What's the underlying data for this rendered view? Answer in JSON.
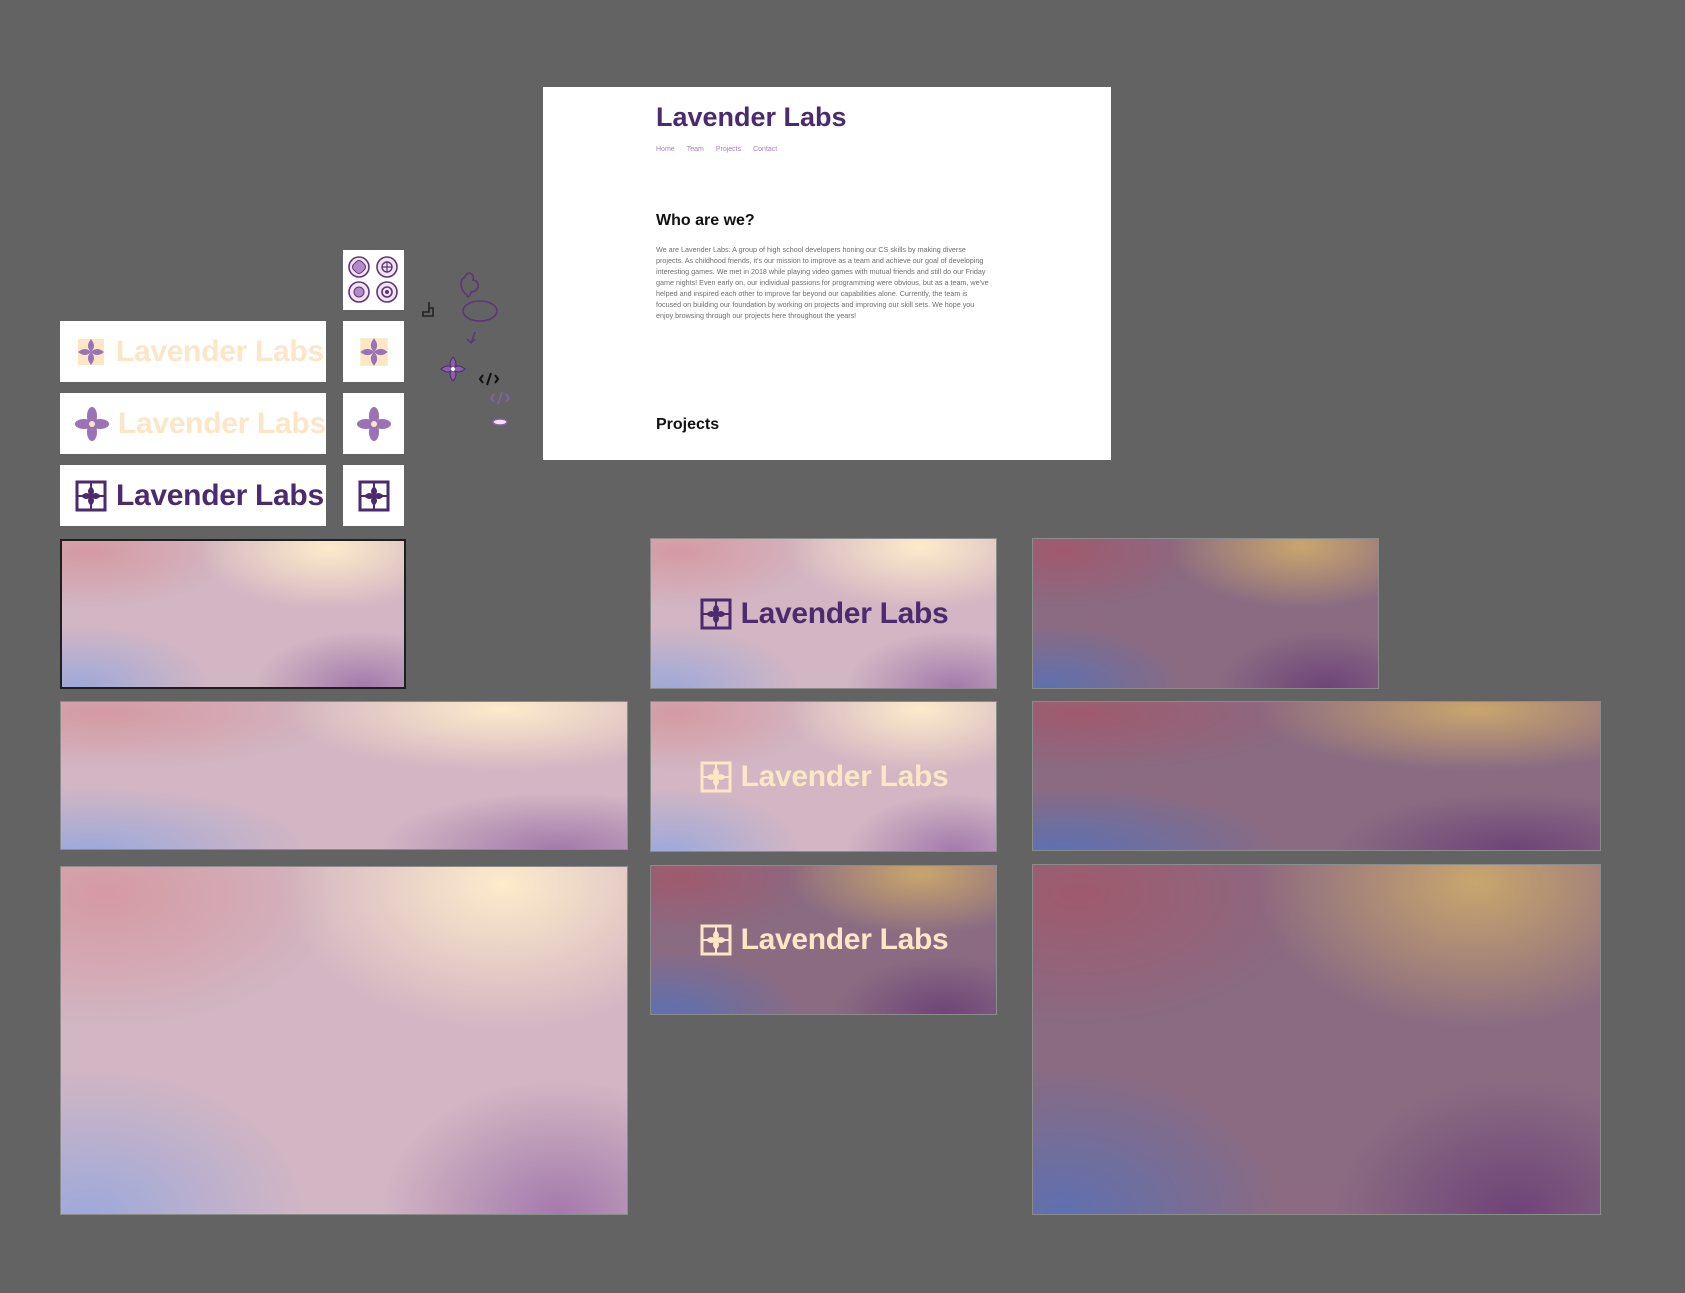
{
  "brand": {
    "name": "Lavender Labs",
    "colors": {
      "purple": "#4b2a6d",
      "cream": "#fcebcc",
      "lavender": "#8a5fa8",
      "canvas": "#636363"
    }
  },
  "website": {
    "title": "Lavender Labs",
    "nav": [
      "Home",
      "Team",
      "Projects",
      "Contact"
    ],
    "about_heading": "Who are we?",
    "about_text": "We are Lavender Labs: A group of high school developers honing our CS skills by making diverse projects. As childhood friends, it's our mission to improve as a team and achieve our goal of developing interesting games. We met in 2018 while playing video games with mutual friends and still do our Friday game nights! Even early on, our individual passions for programming were obvious, but as a team, we've helped and inspired each other to improve far beyond our capabilities alone. Currently, the team is focused on building our foundation by working on projects and improving our skill sets. We hope you enjoy browsing through our projects here throughout the years!",
    "projects_heading": "Projects"
  },
  "icons": {
    "emblem_grid": [
      "emblem-1-icon",
      "emblem-2-icon",
      "emblem-3-icon",
      "emblem-4-icon"
    ],
    "flower": "flower-icon",
    "framed_flower": "framed-flower-icon",
    "code": "code-icon"
  }
}
